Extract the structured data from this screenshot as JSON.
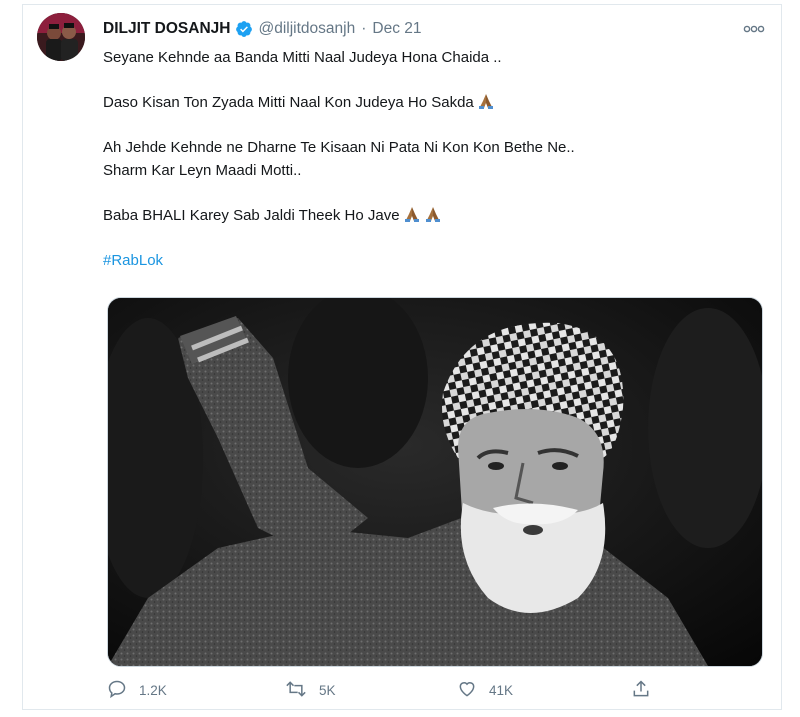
{
  "tweet": {
    "author_name": "DILJIT DOSANJH",
    "handle": "@diljitdosanjh",
    "separator": "·",
    "date": "Dec 21",
    "lines": {
      "l1": "Seyane Kehnde aa Banda Mitti Naal Judeya Hona Chaida ..",
      "l2": "Daso Kisan Ton Zyada Mitti Naal Kon Judeya Ho Sakda",
      "l3": "Ah Jehde Kehnde ne Dharne Te Kisaan Ni Pata Ni Kon Kon Bethe Ne..",
      "l4": "Sharm Kar Leyn Maadi Motti..",
      "l5": "Baba BHALI Karey Sab Jaldi Theek Ho Jave"
    },
    "hashtag": "#RabLok"
  },
  "actions": {
    "replies": "1.2K",
    "retweets": "5K",
    "likes": "41K"
  },
  "colors": {
    "link": "#1b95e0",
    "verified": "#1da1f2",
    "muted": "#657786"
  },
  "icons": [
    "verified-badge-icon",
    "more-options-icon",
    "folded-hands-emoji",
    "reply-icon",
    "retweet-icon",
    "like-icon",
    "share-icon"
  ]
}
